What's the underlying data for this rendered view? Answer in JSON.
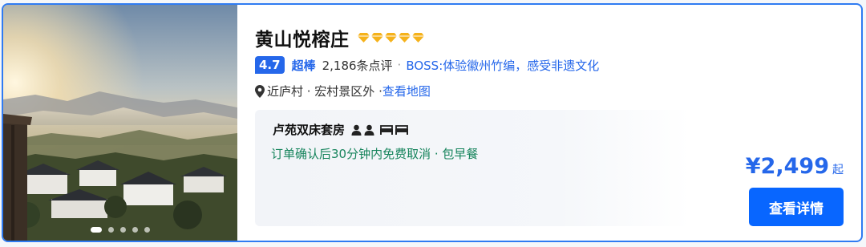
{
  "hotel": {
    "name": "黄山悦榕庄",
    "diamond_count": 5,
    "diamond_color": "#f5b21b",
    "score": "4.7",
    "score_word": "超棒",
    "reviews": "2,186条点评",
    "separator": "·",
    "highlight": "BOSS:体验徽州竹编，感受非遗文化",
    "location": "近庐村 · 宏村景区外 · ",
    "map_link": "查看地图"
  },
  "room": {
    "name": "卢苑双床套房",
    "icons": [
      "person-icon",
      "person-icon",
      "bed-icon",
      "bed-icon"
    ],
    "policy": "订单确认后30分钟内免费取消 · 包早餐"
  },
  "price": {
    "amount": "¥2,499",
    "suffix": "起"
  },
  "actions": {
    "detail_label": "查看详情"
  },
  "photo": {
    "slide_count": 5,
    "active_slide": 1
  },
  "colors": {
    "accent": "#2567ea",
    "button": "#0866ff",
    "green": "#16845c",
    "border": "#2f7bf2"
  }
}
